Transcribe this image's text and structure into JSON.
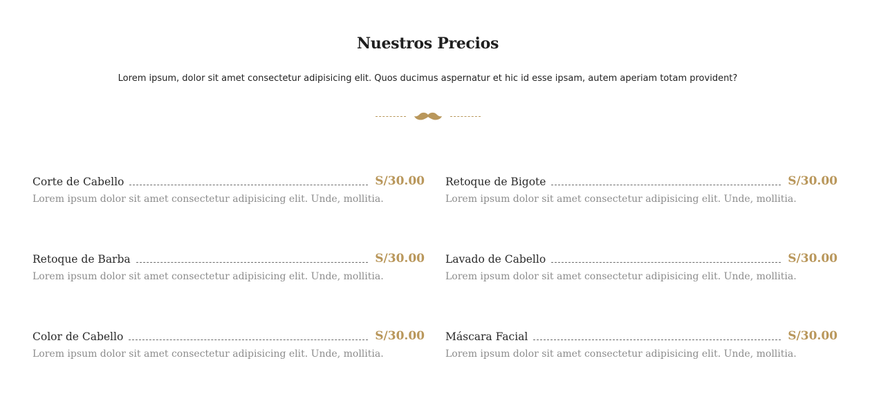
{
  "header": {
    "title": "Nuestros Precios",
    "subtitle": "Lorem ipsum, dolor sit amet consectetur adipisicing elit. Quos ducimus aspernatur et hic id esse ipsam, autem aperiam totam provident?"
  },
  "divider": {
    "icon": "mustache-icon",
    "color": "#b9975b"
  },
  "prices": [
    {
      "name": "Corte de Cabello",
      "price": "S/30.00",
      "description": "Lorem ipsum dolor sit amet consectetur adipisicing elit. Unde, mollitia."
    },
    {
      "name": "Retoque de Bigote",
      "price": "S/30.00",
      "description": "Lorem ipsum dolor sit amet consectetur adipisicing elit. Unde, mollitia."
    },
    {
      "name": "Retoque de Barba",
      "price": "S/30.00",
      "description": "Lorem ipsum dolor sit amet consectetur adipisicing elit. Unde, mollitia."
    },
    {
      "name": "Lavado de Cabello",
      "price": "S/30.00",
      "description": "Lorem ipsum dolor sit amet consectetur adipisicing elit. Unde, mollitia."
    },
    {
      "name": "Color de Cabello",
      "price": "S/30.00",
      "description": "Lorem ipsum dolor sit amet consectetur adipisicing elit. Unde, mollitia."
    },
    {
      "name": "Máscara Facial",
      "price": "S/30.00",
      "description": "Lorem ipsum dolor sit amet consectetur adipisicing elit. Unde, mollitia."
    }
  ],
  "colors": {
    "accent": "#b9975b",
    "heading": "#1f1f1f",
    "muted": "#8c8c8c"
  }
}
